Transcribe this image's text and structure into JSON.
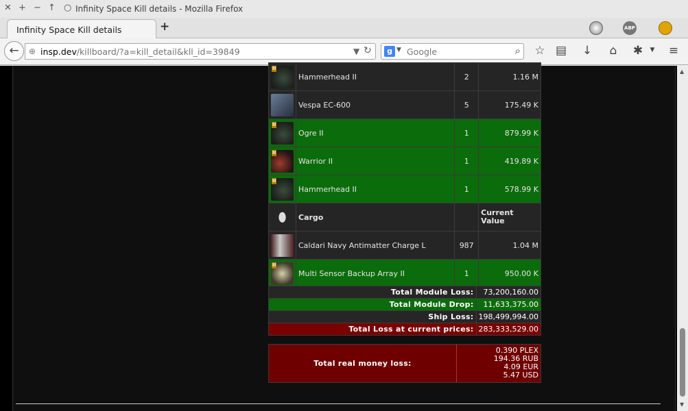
{
  "window": {
    "title": "Infinity Space Kill details - Mozilla Firefox"
  },
  "tab": {
    "label": "Infinity Space Kill details"
  },
  "urlbar": {
    "host": "insp.dev",
    "path": "/killboard/?a=kill_detail&kll_id=39849"
  },
  "search": {
    "placeholder": "Google"
  },
  "items": [
    {
      "name": "Hammerhead II",
      "qty": "2",
      "value": "1.16 M",
      "dropped": false,
      "icon": "drone-icon",
      "t2": true
    },
    {
      "name": "Vespa EC-600",
      "qty": "5",
      "value": "175.49 K",
      "dropped": false,
      "icon": "drone-icon",
      "t2": false
    },
    {
      "name": "Ogre II",
      "qty": "1",
      "value": "879.99 K",
      "dropped": true,
      "icon": "drone-icon",
      "t2": true
    },
    {
      "name": "Warrior II",
      "qty": "1",
      "value": "419.89 K",
      "dropped": true,
      "icon": "drone-icon",
      "t2": true
    },
    {
      "name": "Hammerhead II",
      "qty": "1",
      "value": "578.99 K",
      "dropped": true,
      "icon": "drone-icon",
      "t2": true
    }
  ],
  "cargo_header": {
    "label": "Cargo",
    "value_header": "Current Value",
    "icon": "cargo-icon"
  },
  "cargo": [
    {
      "name": "Caldari Navy Antimatter Charge L",
      "qty": "987",
      "value": "1.04 M",
      "dropped": false,
      "icon": "charge-icon"
    },
    {
      "name": "Multi Sensor Backup Array II",
      "qty": "1",
      "value": "950.00 K",
      "dropped": true,
      "icon": "sensor-icon",
      "t2": true
    }
  ],
  "summary": [
    {
      "label": "Total Module Loss:",
      "value": "73,200,160.00",
      "style": "dark"
    },
    {
      "label": "Total Module Drop:",
      "value": "11,633,375.00",
      "style": "green"
    },
    {
      "label": "Ship Loss:",
      "value": "198,499,994.00",
      "style": "dark"
    },
    {
      "label": "Total Loss at current prices:",
      "value": "283,333,529.00",
      "style": "red"
    }
  ],
  "money": {
    "label": "Total real money loss:",
    "values": [
      "0.390 PLEX",
      "194.36 RUB",
      "4.09 EUR",
      "5.47 USD"
    ]
  },
  "colors": {
    "dropped": "#0b6c0b",
    "destroyed": "#252525",
    "loss": "#7a0000"
  }
}
